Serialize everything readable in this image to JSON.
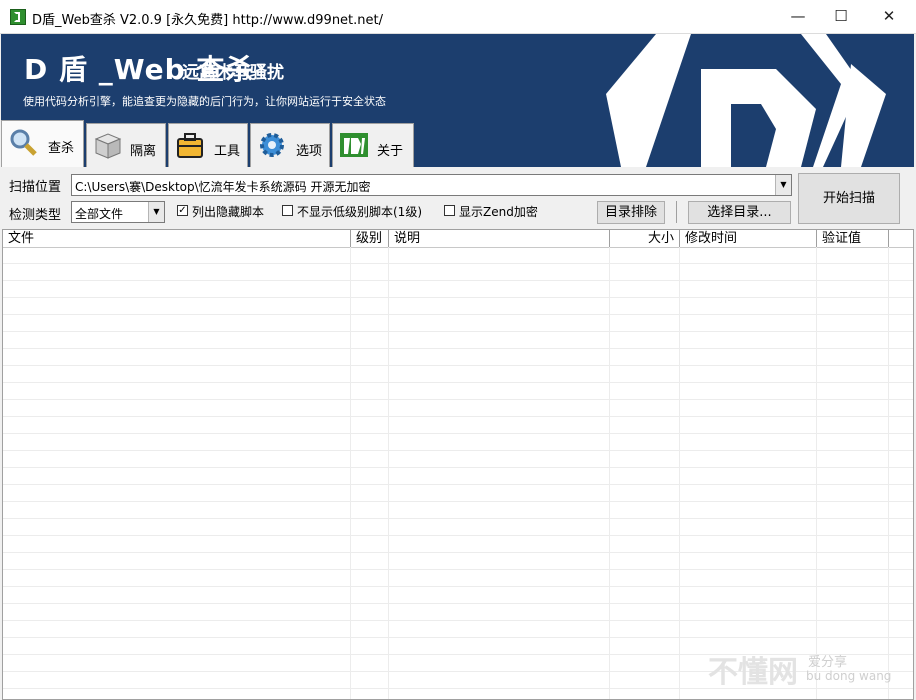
{
  "window": {
    "title": "D盾_Web查杀 V2.0.9 [永久免费] http://www.d99net.net/",
    "controls": {
      "minimize": "—",
      "maximize": "☐",
      "close": "✕"
    }
  },
  "banner": {
    "title": "D 盾 _Web 查杀",
    "subtitle": "远离木马骚扰",
    "description": "使用代码分析引擎，能追查更为隐藏的后门行为，让你网站运行于安全状态",
    "colors": {
      "background": "#1c3e6e"
    }
  },
  "tabs": [
    {
      "label": "查杀",
      "icon": "magnifier-icon"
    },
    {
      "label": "隔离",
      "icon": "box-icon"
    },
    {
      "label": "工具",
      "icon": "toolbox-icon"
    },
    {
      "label": "选项",
      "icon": "gear-icon"
    },
    {
      "label": "关于",
      "icon": "dshield-logo-icon"
    }
  ],
  "scan": {
    "path_label": "扫描位置",
    "path_value": "C:\\Users\\褰\\Desktop\\忆流年发卡系统源码 开源无加密",
    "type_label": "检测类型",
    "type_value": "全部文件",
    "options": [
      {
        "label": "列出隐藏脚本",
        "checked": true,
        "mark": "✓"
      },
      {
        "label": "不显示低级别脚本(1级)",
        "checked": false,
        "mark": ""
      },
      {
        "label": "显示Zend加密",
        "checked": false,
        "mark": ""
      }
    ],
    "exclude_button": "目录排除",
    "choose_button": "选择目录...",
    "start_button": "开始扫描"
  },
  "table": {
    "columns": [
      "文件",
      "级别",
      "说明",
      "大小",
      "修改时间",
      "验证值"
    ],
    "rows": []
  },
  "watermark": {
    "main": "不懂网",
    "side": "爱分享",
    "pinyin": "bu dong wang"
  }
}
